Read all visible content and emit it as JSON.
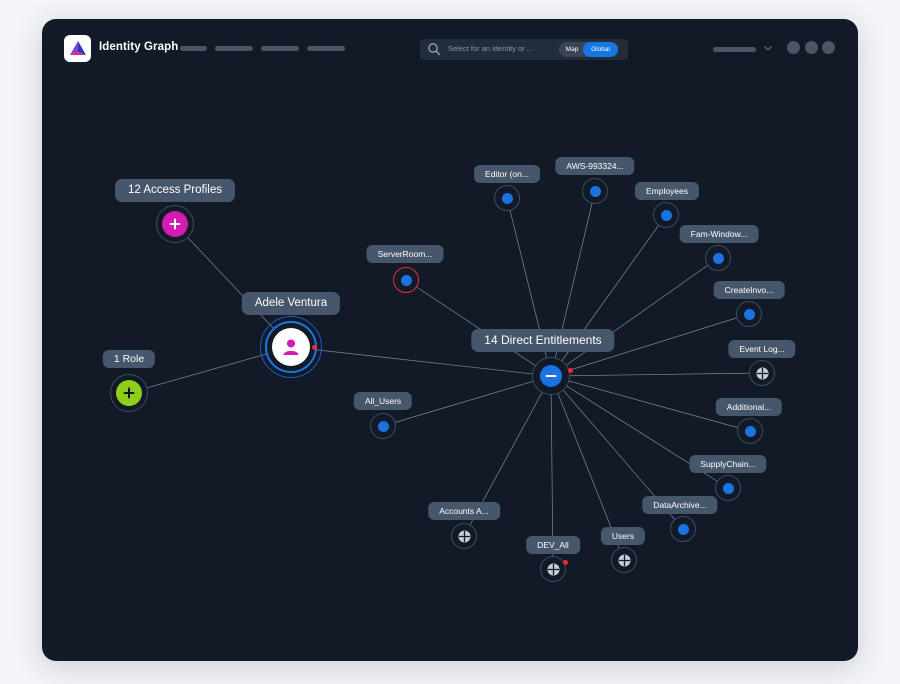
{
  "app": {
    "title": "Identity Graph"
  },
  "colors": {
    "window": "#131a27",
    "accent": "#1578e0",
    "node_blue": "#1a73e0",
    "profile_magenta": "#d41bb4",
    "role_green": "#8fce1a",
    "alert_red": "#ee2a35",
    "label_bg": "#46566b"
  },
  "search": {
    "placeholder": "Select for an identity or ...",
    "icon": "search-icon",
    "view_options": [
      "Map",
      "Global"
    ],
    "selected_view": "Global"
  },
  "graph": {
    "identity": {
      "name": "Adele Ventura",
      "icon": "person-icon"
    },
    "access_profiles": {
      "label": "12 Access Profiles",
      "icon": "plus-icon"
    },
    "roles": {
      "label": "1 Role",
      "icon": "plus-icon"
    },
    "entitlements_hub": {
      "label": "14 Direct Entitlements",
      "icon": "minus-icon"
    },
    "entitlements": [
      {
        "label": "Editor (on...",
        "kind": "standard"
      },
      {
        "label": "AWS-993324...",
        "kind": "standard"
      },
      {
        "label": "Employees",
        "kind": "standard"
      },
      {
        "label": "Fam-Window...",
        "kind": "standard"
      },
      {
        "label": "CreateInvo...",
        "kind": "standard"
      },
      {
        "label": "Event Log...",
        "kind": "group"
      },
      {
        "label": "Additional...",
        "kind": "standard"
      },
      {
        "label": "SupplyChain...",
        "kind": "standard"
      },
      {
        "label": "DataArchive...",
        "kind": "standard"
      },
      {
        "label": "Users",
        "kind": "group"
      },
      {
        "label": "DEV_All",
        "kind": "group"
      },
      {
        "label": "Accounts A...",
        "kind": "group"
      },
      {
        "label": "All_Users",
        "kind": "standard"
      },
      {
        "label": "ServerRoom...",
        "kind": "alert"
      }
    ]
  }
}
